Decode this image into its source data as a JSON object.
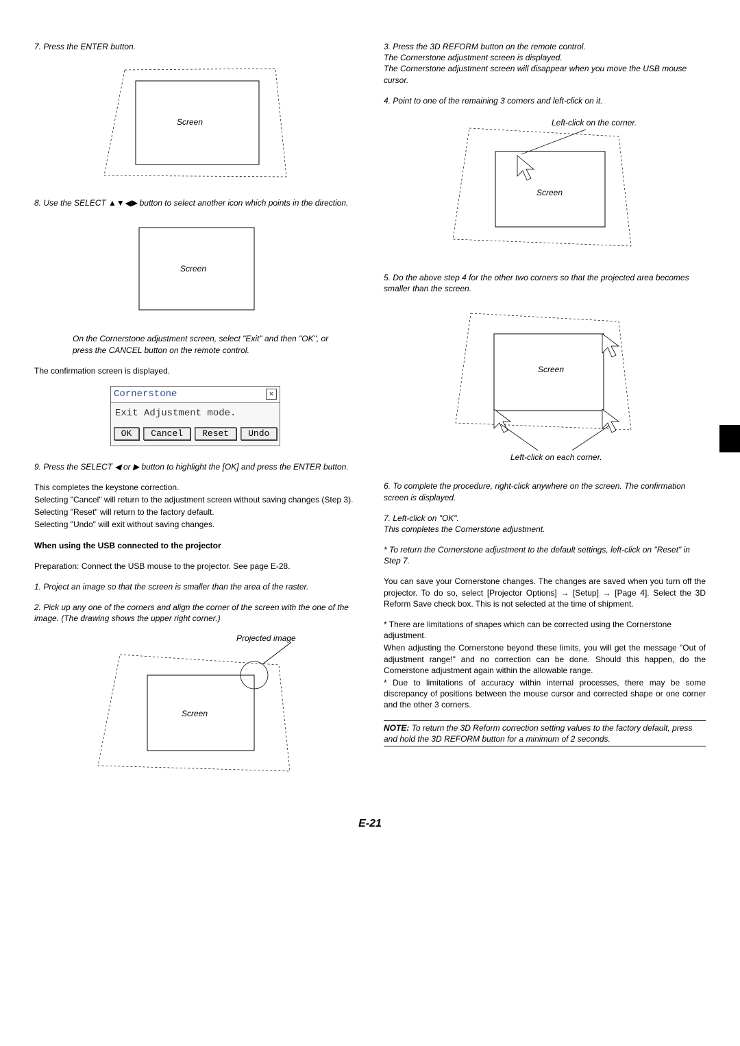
{
  "page_number": "E-21",
  "left": {
    "s7": "7. Press the ENTER button.",
    "s8": "8. Use the SELECT ▲▼◀▶ button to select another icon which points in the direction.",
    "indent_cornerstone": "On the Cornerstone adjustment screen, select \"Exit\" and then \"OK\", or press the CANCEL button on the remote control.",
    "confirm_disp": "The confirmation screen is displayed.",
    "dlg_title": "Cornerstone",
    "dlg_msg": "Exit Adjustment mode.",
    "dlg_ok": "OK",
    "dlg_cancel": "Cancel",
    "dlg_reset": "Reset",
    "dlg_undo": "Undo",
    "s9": "9. Press the SELECT ◀ or ▶ button to highlight the [OK] and press the ENTER button.",
    "completes": "This completes the keystone correction.",
    "cancel_txt": "Selecting \"Cancel\" will return to the adjustment screen without saving changes (Step 3).",
    "reset_txt": "Selecting \"Reset\" will return to the factory default.",
    "undo_txt": "Selecting \"Undo\" will exit without saving changes.",
    "usb_head": "When using the USB connected to the projector",
    "prep": "Preparation: Connect the USB mouse to the projector. See page E-28.",
    "u1": "1. Project an image so that the screen is smaller than the area of the raster.",
    "u2": "2. Pick up any one of the corners and align the corner of the screen with the one of the image. (The drawing shows the upper right corner.)",
    "proj_label": "Projected image",
    "screen_label": "Screen"
  },
  "right": {
    "s3": "3. Press the 3D REFORM button on the remote control.\nThe Cornerstone adjustment screen is displayed.\nThe Cornerstone adjustment screen will disappear when you move the USB mouse cursor.",
    "s4": "4. Point to one of the remaining 3 corners and left-click on it.",
    "click_corner": "Left-click on the corner.",
    "screen_label": "Screen",
    "s5": "5. Do the above step 4 for the other two corners so that the projected area becomes smaller than the screen.",
    "click_each": "Left-click on each corner.",
    "s6": "6. To complete the procedure, right-click anywhere on the screen. The confirmation screen is displayed.",
    "s7": "7. Left-click on \"OK\".\nThis completes the Cornerstone adjustment.",
    "star1": "* To return the Cornerstone adjustment to the default settings, left-click on \"Reset\" in Step 7.",
    "save_para": "You can save your Cornerstone changes. The changes are saved when you turn off the projector. To do so, select [Projector Options] → [Setup] → [Page 4]. Select the 3D Reform Save check box. This is not selected at the time of shipment.",
    "star2": "* There are limitations of shapes which can be corrected using the Cornerstone adjustment.",
    "limits": "When adjusting the Cornerstone beyond these limits, you will get the message \"Out of adjustment range!\" and no correction can be done. Should this happen, do the Cornerstone adjustment again within the allowable range.",
    "star3": "* Due to limitations of accuracy within internal processes, there may be some discrepancy of positions between the mouse cursor and corrected shape or one corner and the other 3 corners.",
    "note": "NOTE: To return the 3D Reform correction setting values to the factory default, press and hold the 3D REFORM button for a minimum of 2 seconds."
  }
}
